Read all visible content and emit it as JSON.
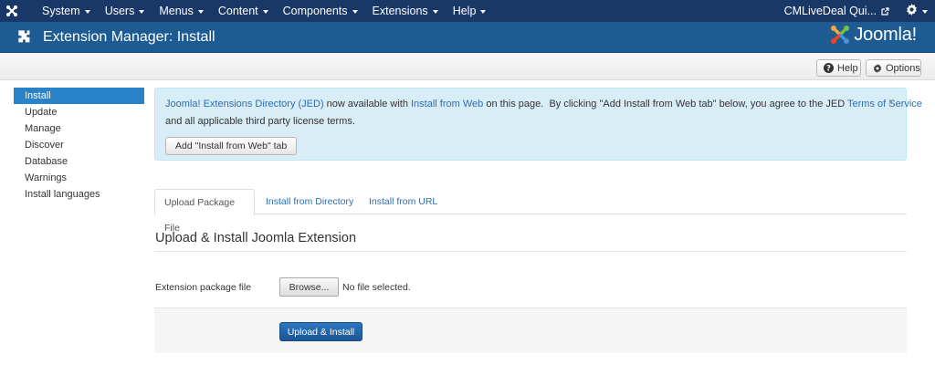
{
  "navbar": {
    "menu": [
      {
        "label": "System",
        "name": "nav-system"
      },
      {
        "label": "Users",
        "name": "nav-users"
      },
      {
        "label": "Menus",
        "name": "nav-menus"
      },
      {
        "label": "Content",
        "name": "nav-content"
      },
      {
        "label": "Components",
        "name": "nav-components"
      },
      {
        "label": "Extensions",
        "name": "nav-extensions"
      },
      {
        "label": "Help",
        "name": "nav-help"
      }
    ],
    "site_link": "CMLiveDeal Qui...",
    "logo_icon": "joomla-icon",
    "user_menu_icon": "gear-icon"
  },
  "header": {
    "title": "Extension Manager: Install",
    "icon": "puzzle-icon",
    "brand": "Joomla!"
  },
  "toolbar": {
    "help_label": "Help",
    "options_label": "Options"
  },
  "sidebar": {
    "items": [
      {
        "label": "Install",
        "active": true
      },
      {
        "label": "Update",
        "active": false
      },
      {
        "label": "Manage",
        "active": false
      },
      {
        "label": "Discover",
        "active": false
      },
      {
        "label": "Database",
        "active": false
      },
      {
        "label": "Warnings",
        "active": false
      },
      {
        "label": "Install languages",
        "active": false
      }
    ]
  },
  "alert": {
    "jed_link": "Joomla! Extensions Directory (JED)",
    "text_a": " now available with ",
    "install_web_link": "Install from Web",
    "text_b": " on this page.  By clicking \"Add Install from Web tab\" below, you agree to the JED ",
    "tos_link": "Terms of Service",
    "text_c": "and all applicable third party license terms.",
    "button_label": "Add \"Install from Web\" tab",
    "close": "×"
  },
  "tabs": [
    {
      "label": "Upload Package File",
      "active": true
    },
    {
      "label": "Install from Directory",
      "active": false
    },
    {
      "label": "Install from URL",
      "active": false
    }
  ],
  "form": {
    "section_title": "Upload & Install Joomla Extension",
    "field_label": "Extension package file",
    "browse_label": "Browse...",
    "file_status": "No file selected.",
    "submit_label": "Upload & Install"
  },
  "colors": {
    "navbar": "#1a3867",
    "header": "#1d5b92",
    "accent": "#2a82c8",
    "link": "#2a6fb5",
    "alert_bg": "#d9edf7"
  }
}
